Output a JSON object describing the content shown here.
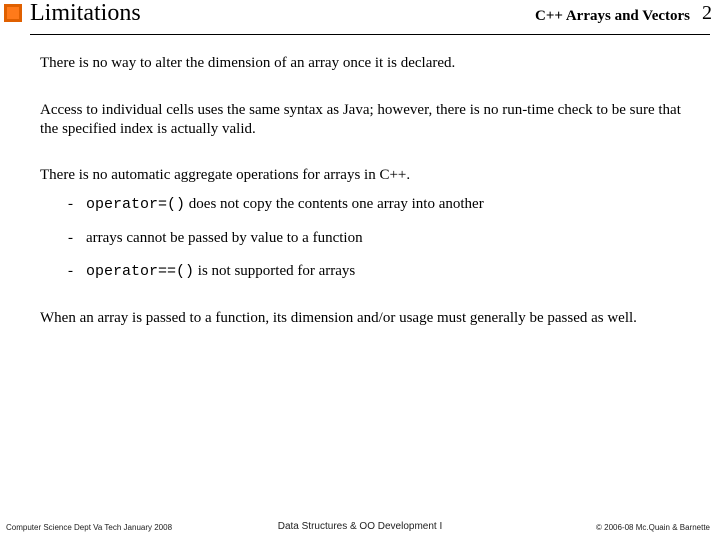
{
  "header": {
    "title": "Limitations",
    "topic": "C++ Arrays and Vectors",
    "page": "2"
  },
  "body": {
    "p1": "There is no way to alter the dimension of an array once it is declared.",
    "p2": "Access to individual cells uses the same syntax as Java; however, there is no run-time check to be sure that the specified index is actually valid.",
    "p3": "There is no automatic aggregate operations for arrays in C++.",
    "items": {
      "i1_code": "operator=()",
      "i1_rest": " does not copy the contents one array into another",
      "i2": "arrays cannot be passed by value to a function",
      "i3_code": "operator==()",
      "i3_rest": " is not supported for arrays"
    },
    "p4": "When an array is passed to a function, its dimension and/or usage must generally be passed as well."
  },
  "footer": {
    "left": "Computer Science Dept Va Tech January 2008",
    "center": "Data Structures & OO Development I",
    "right": "© 2006-08 Mc.Quain & Barnette"
  }
}
